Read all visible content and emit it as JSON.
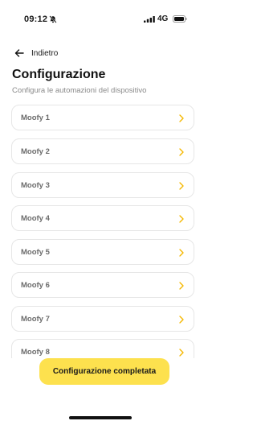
{
  "status_bar": {
    "time": "09:12",
    "network": "4G"
  },
  "header": {
    "back_label": "Indietro"
  },
  "page": {
    "title": "Configurazione",
    "subtitle": "Configura le automazioni del dispositivo"
  },
  "devices": [
    {
      "label": "Moofy 1"
    },
    {
      "label": "Moofy 2"
    },
    {
      "label": "Moofy 3"
    },
    {
      "label": "Moofy 4"
    },
    {
      "label": "Moofy 5"
    },
    {
      "label": "Moofy 6"
    },
    {
      "label": "Moofy 7"
    },
    {
      "label": "Moofy 8"
    }
  ],
  "actions": {
    "complete_label": "Configurazione completata"
  },
  "colors": {
    "accent": "#fde14e",
    "chevron": "#f5b800"
  },
  "icons": {
    "back": "arrow-left-icon",
    "item": "chevron-right-icon",
    "silent": "bell-slash-icon",
    "signal": "signal-icon",
    "battery": "battery-icon"
  }
}
